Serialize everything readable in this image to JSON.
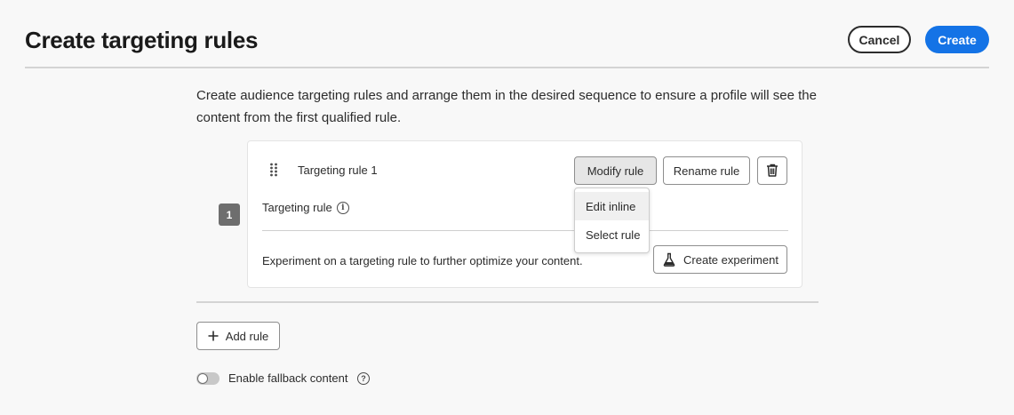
{
  "header": {
    "title": "Create targeting rules",
    "cancel_label": "Cancel",
    "create_label": "Create"
  },
  "intro": "Create audience targeting rules and arrange them in the desired sequence to ensure a profile will see the content from the first qualified rule.",
  "rules": [
    {
      "index": "1",
      "name": "Targeting rule 1",
      "modify_label": "Modify rule",
      "rename_label": "Rename rule",
      "targeting_label": "Targeting rule",
      "experiment_text": "Experiment on a targeting rule to further optimize your content.",
      "experiment_button": "Create experiment"
    }
  ],
  "modify_menu": {
    "items": [
      "Edit inline",
      "Select rule"
    ]
  },
  "add_rule_label": "Add rule",
  "fallback": {
    "label": "Enable fallback content",
    "enabled": false
  },
  "colors": {
    "accent": "#1473e6",
    "badge": "#6e6e6e"
  }
}
